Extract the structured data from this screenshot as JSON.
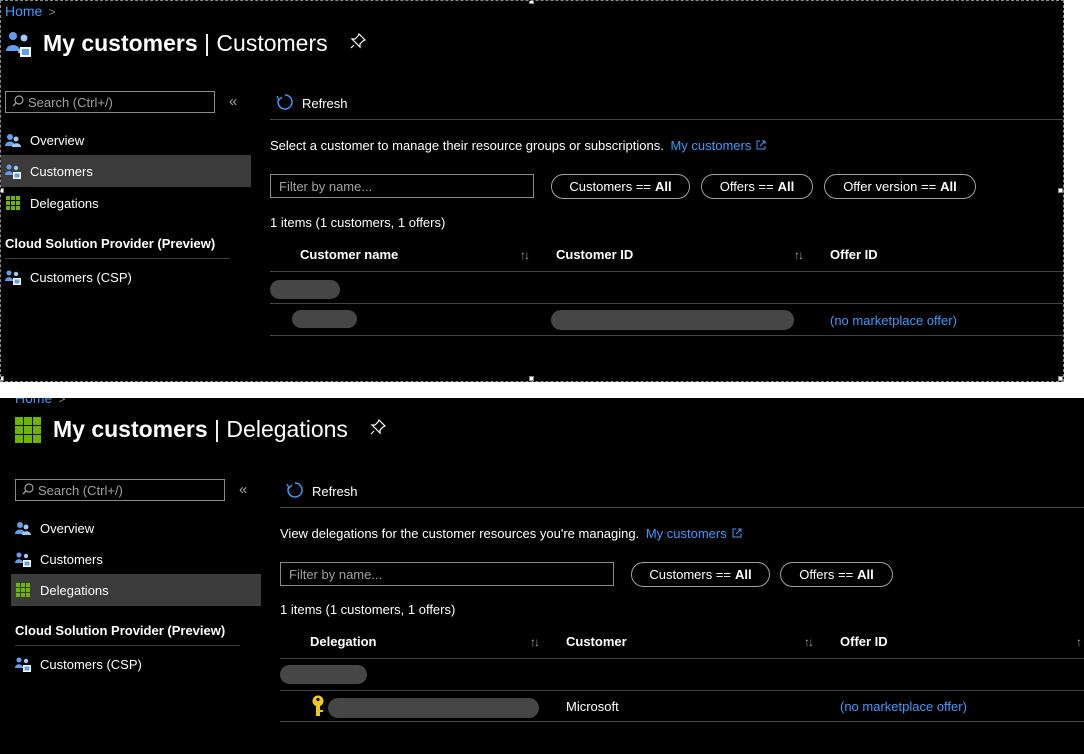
{
  "panels": [
    {
      "breadcrumb": {
        "home": "Home",
        "separator": ">"
      },
      "title_bold": "My customers",
      "title_rest": " | Customers",
      "search_placeholder": "Search (Ctrl+/)",
      "collapse": "«",
      "nav": [
        {
          "label": "Overview",
          "icon": "overview-icon"
        },
        {
          "label": "Customers",
          "icon": "customers-icon",
          "active": true
        },
        {
          "label": "Delegations",
          "icon": "delegations-icon"
        }
      ],
      "section": "Cloud Solution Provider (Preview)",
      "section_items": [
        {
          "label": "Customers (CSP)",
          "icon": "customers-csp-icon"
        }
      ],
      "refresh": "Refresh",
      "description": "Select a customer to manage their resource groups or subscriptions.",
      "description_link": "My customers",
      "filter_placeholder": "Filter by name...",
      "pills": [
        {
          "prefix": "Customers ==",
          "value": "All"
        },
        {
          "prefix": "Offers ==",
          "value": "All"
        },
        {
          "prefix": "Offer version ==",
          "value": "All"
        }
      ],
      "count": "1 items (1 customers, 1 offers)",
      "columns": [
        "Customer name",
        "Customer ID",
        "Offer ID"
      ],
      "rows": [
        {
          "offer": "(no marketplace offer)"
        }
      ]
    },
    {
      "breadcrumb": {
        "home": "Home",
        "separator": ">"
      },
      "title_bold": "My customers",
      "title_rest": " | Delegations",
      "search_placeholder": "Search (Ctrl+/)",
      "collapse": "«",
      "nav": [
        {
          "label": "Overview",
          "icon": "overview-icon"
        },
        {
          "label": "Customers",
          "icon": "customers-icon"
        },
        {
          "label": "Delegations",
          "icon": "delegations-icon",
          "active": true
        }
      ],
      "section": "Cloud Solution Provider (Preview)",
      "section_items": [
        {
          "label": "Customers (CSP)",
          "icon": "customers-csp-icon"
        }
      ],
      "refresh": "Refresh",
      "description": "View delegations for the customer resources you're managing.",
      "description_link": "My customers",
      "filter_placeholder": "Filter by name...",
      "pills": [
        {
          "prefix": "Customers ==",
          "value": "All"
        },
        {
          "prefix": "Offers ==",
          "value": "All"
        }
      ],
      "count": "1 items (1 customers, 1 offers)",
      "columns": [
        "Delegation",
        "Customer",
        "Offer ID"
      ],
      "rows": [
        {
          "customer": "Microsoft",
          "offer": "(no marketplace offer)",
          "icon": "key-icon"
        }
      ]
    }
  ],
  "colors": {
    "background": "#000000",
    "link": "#3b9aff",
    "active_nav": "#3b3b3b",
    "redaction": "#464646"
  }
}
